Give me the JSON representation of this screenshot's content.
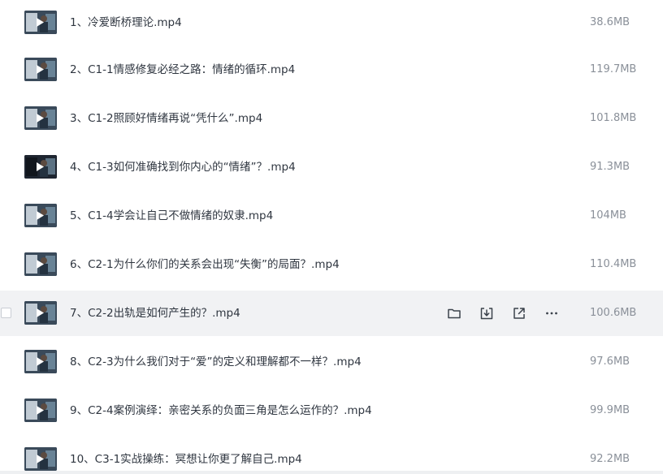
{
  "files": [
    {
      "name": "1、冷爱断桥理论.mp4",
      "size": "38.6MB",
      "thumb": "light"
    },
    {
      "name": "2、C1-1情感修复必经之路：情绪的循环.mp4",
      "size": "119.7MB",
      "thumb": "light"
    },
    {
      "name": "3、C1-2照顾好情绪再说“凭什么”.mp4",
      "size": "101.8MB",
      "thumb": "light"
    },
    {
      "name": "4、C1-3如何准确找到你内心的“情绪”？.mp4",
      "size": "91.3MB",
      "thumb": "dark"
    },
    {
      "name": "5、C1-4学会让自己不做情绪的奴隶.mp4",
      "size": "104MB",
      "thumb": "light"
    },
    {
      "name": "6、C2-1为什么你们的关系会出现“失衡”的局面？.mp4",
      "size": "110.4MB",
      "thumb": "light"
    },
    {
      "name": "7、C2-2出轨是如何产生的？.mp4",
      "size": "100.6MB",
      "thumb": "light"
    },
    {
      "name": "8、C2-3为什么我们对于“爱”的定义和理解都不一样？.mp4",
      "size": "97.6MB",
      "thumb": "light"
    },
    {
      "name": "9、C2-4案例演绎：亲密关系的负面三角是怎么运作的？.mp4",
      "size": "99.9MB",
      "thumb": "light"
    },
    {
      "name": "10、C3-1实战操练：冥想让你更了解自己.mp4",
      "size": "92.2MB",
      "thumb": "light"
    }
  ],
  "hovered_index": 6,
  "row_actions": [
    {
      "icon": "folder-icon"
    },
    {
      "icon": "download-icon"
    },
    {
      "icon": "share-icon"
    },
    {
      "icon": "more-icon"
    }
  ]
}
